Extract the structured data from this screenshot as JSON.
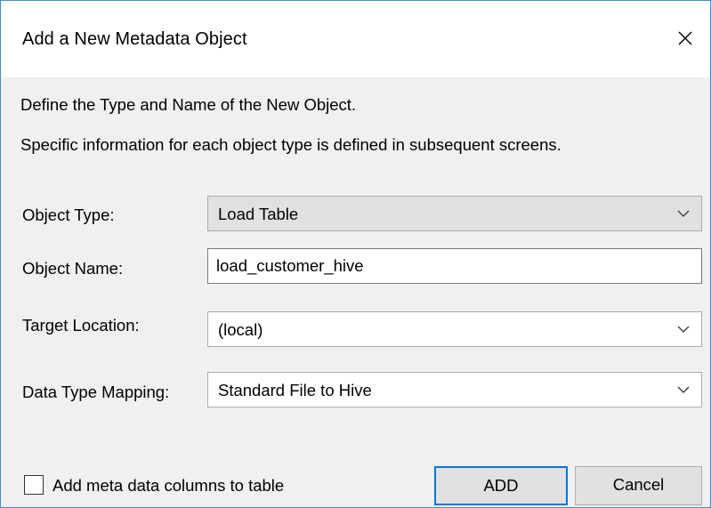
{
  "window": {
    "title": "Add a New Metadata Object",
    "close_icon": "close-icon",
    "accent_border": "#3c8fd6"
  },
  "description": {
    "line1": "Define the Type and Name of the New Object.",
    "line2": "Specific information for each object type is defined in subsequent screens."
  },
  "fields": {
    "object_type": {
      "label": "Object Type:",
      "value": "Load Table"
    },
    "object_name": {
      "label": "Object Name:",
      "value": "load_customer_hive"
    },
    "target_location": {
      "label": "Target Location:",
      "value": "(local)"
    },
    "data_type_mapping": {
      "label": "Data Type Mapping:",
      "value": "Standard File to Hive"
    }
  },
  "options": {
    "add_meta_columns": {
      "label": "Add meta data columns to table",
      "checked": false
    }
  },
  "buttons": {
    "add": "ADD",
    "cancel": "Cancel",
    "default_accent": "#0078d7"
  }
}
